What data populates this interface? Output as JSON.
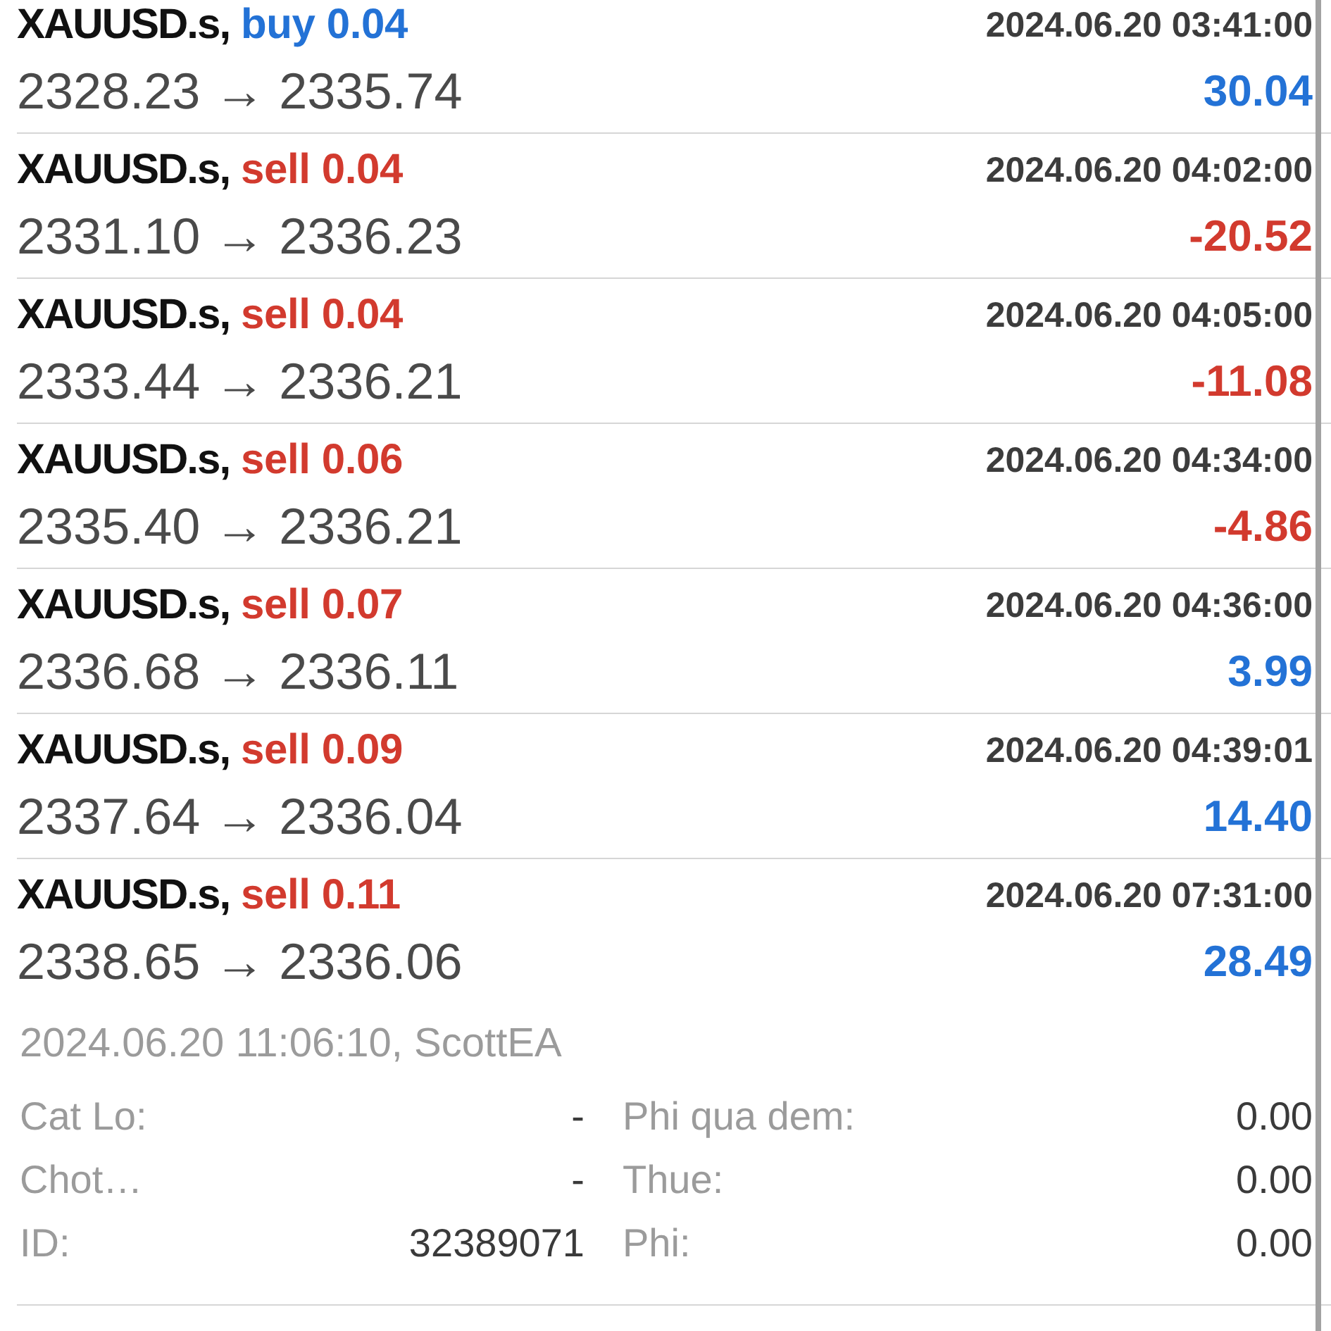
{
  "deals": [
    {
      "symbol": "XAUUSD.s,",
      "kind": "buy",
      "order": "buy 0.04",
      "time": "2024.06.20 03:41:00",
      "prices": "2328.23 → 2335.74",
      "profit": "30.04",
      "loss": false,
      "expanded": false
    },
    {
      "symbol": "XAUUSD.s,",
      "kind": "sell",
      "order": "sell 0.04",
      "time": "2024.06.20 04:02:00",
      "prices": "2331.10 → 2336.23",
      "profit": "-20.52",
      "loss": true,
      "expanded": false
    },
    {
      "symbol": "XAUUSD.s,",
      "kind": "sell",
      "order": "sell 0.04",
      "time": "2024.06.20 04:05:00",
      "prices": "2333.44 → 2336.21",
      "profit": "-11.08",
      "loss": true,
      "expanded": false
    },
    {
      "symbol": "XAUUSD.s,",
      "kind": "sell",
      "order": "sell 0.06",
      "time": "2024.06.20 04:34:00",
      "prices": "2335.40 → 2336.21",
      "profit": "-4.86",
      "loss": true,
      "expanded": false
    },
    {
      "symbol": "XAUUSD.s,",
      "kind": "sell",
      "order": "sell 0.07",
      "time": "2024.06.20 04:36:00",
      "prices": "2336.68 → 2336.11",
      "profit": "3.99",
      "loss": false,
      "expanded": false
    },
    {
      "symbol": "XAUUSD.s,",
      "kind": "sell",
      "order": "sell 0.09",
      "time": "2024.06.20 04:39:01",
      "prices": "2337.64 → 2336.04",
      "profit": "14.40",
      "loss": false,
      "expanded": false
    },
    {
      "symbol": "XAUUSD.s,",
      "kind": "sell",
      "order": "sell 0.11",
      "time": "2024.06.20 07:31:00",
      "prices": "2338.65 → 2336.06",
      "profit": "28.49",
      "loss": false,
      "expanded": true,
      "details": {
        "comment": "2024.06.20 11:06:10, ScottEA",
        "fields": [
          {
            "label": "Cat Lo:",
            "value": "-"
          },
          {
            "label": "Phi qua dem:",
            "value": "0.00"
          },
          {
            "label": "Chot…",
            "value": "-"
          },
          {
            "label": "Thue:",
            "value": "0.00"
          },
          {
            "label": "ID:",
            "value": "32389071"
          },
          {
            "label": "Phi:",
            "value": "0.00"
          }
        ]
      }
    }
  ]
}
